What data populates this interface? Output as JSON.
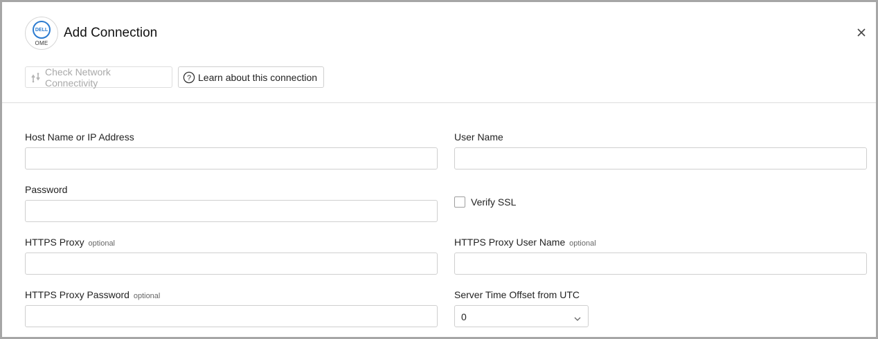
{
  "dialog": {
    "title": "Add Connection",
    "logo": {
      "brand_text": "DELL",
      "sub_text": "OME",
      "accent": "#2b7bd0"
    },
    "close_icon": "close-icon"
  },
  "toolbar": {
    "check_label": "Check Network Connectivity",
    "check_disabled": true,
    "learn_label": "Learn about this connection"
  },
  "form": {
    "host": {
      "label": "Host Name or IP Address",
      "value": ""
    },
    "username": {
      "label": "User Name",
      "value": ""
    },
    "password": {
      "label": "Password",
      "value": ""
    },
    "verify_ssl": {
      "label": "Verify SSL",
      "checked": false
    },
    "proxy": {
      "label": "HTTPS Proxy",
      "optional": "optional",
      "value": ""
    },
    "proxy_user": {
      "label": "HTTPS Proxy User Name",
      "optional": "optional",
      "value": ""
    },
    "proxy_password": {
      "label": "HTTPS Proxy Password",
      "optional": "optional",
      "value": ""
    },
    "time_offset": {
      "label": "Server Time Offset from UTC",
      "value": "0"
    }
  }
}
